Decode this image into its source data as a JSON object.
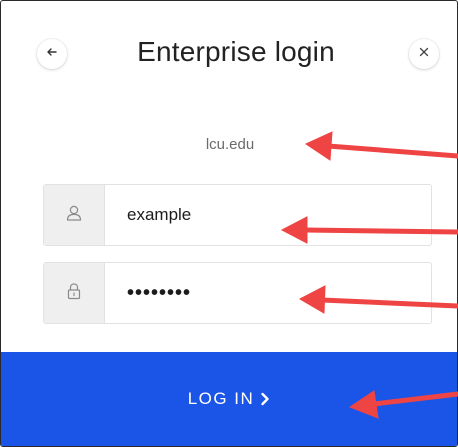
{
  "dialog": {
    "title": "Enterprise login",
    "domain": "lcu.edu"
  },
  "form": {
    "username_value": "example",
    "password_value": "••••••••"
  },
  "actions": {
    "login_label": "LOG IN"
  },
  "colors": {
    "primary": "#1b55e8",
    "annotation": "#ef4444"
  },
  "icons": {
    "back": "arrow-left-icon",
    "close": "close-icon",
    "user": "user-icon",
    "lock": "lock-icon",
    "chevron": "chevron-right-icon"
  }
}
